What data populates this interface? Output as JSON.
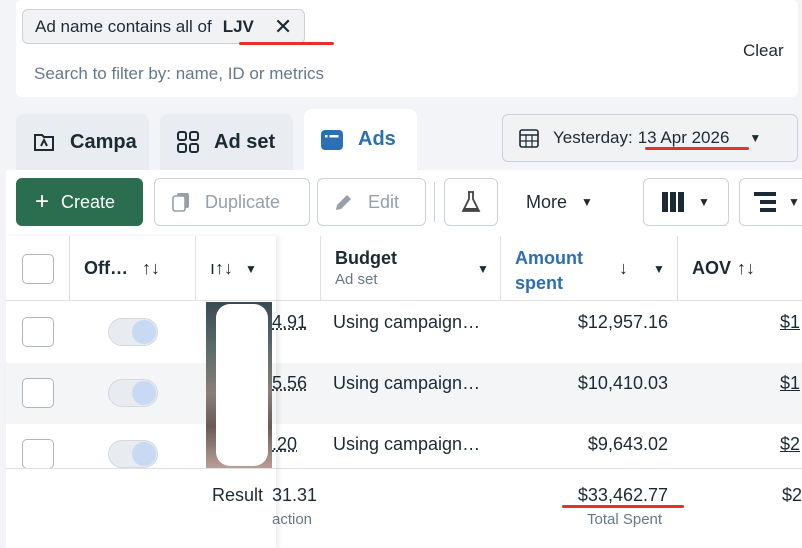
{
  "filter": {
    "chip_prefix": "Ad name contains all of",
    "chip_value": "LJV",
    "search_placeholder": "Search to filter by: name, ID or metrics",
    "clear_label": "Clear"
  },
  "tabs": {
    "campaigns": "Campa",
    "adsets": "Ad set",
    "ads": "Ads"
  },
  "date": {
    "prefix": "Yesterday:",
    "value": "13 Apr 2026"
  },
  "toolbar": {
    "create": "Create",
    "duplicate": "Duplicate",
    "edit": "Edit",
    "more": "More"
  },
  "table": {
    "headers": {
      "off": "Off…",
      "budget": "Budget",
      "budget_sub": "Ad set",
      "amount_line1": "Amount",
      "amount_line2": "spent",
      "aov": "AOV"
    },
    "rows": [
      {
        "cut_value": "4.91",
        "budget": "Using campaign…",
        "amount": "$12,957.16",
        "aov": "$1"
      },
      {
        "cut_value": "5.56",
        "budget": "Using campaign…",
        "amount": "$10,410.03",
        "aov": "$1"
      },
      {
        "cut_value": ".20",
        "budget": "Using campaign…",
        "amount": "$9,643.02",
        "aov": "$2"
      }
    ],
    "summary": {
      "result_label": "Result",
      "cut_value": "31.31",
      "cut_sub": "action",
      "amount": "$33,462.77",
      "amount_sub": "Total Spent",
      "aov": "$2"
    }
  },
  "colors": {
    "accent_blue": "#2c6fb3",
    "create_green": "#2a6e4f",
    "highlight_red": "#e4322b"
  }
}
